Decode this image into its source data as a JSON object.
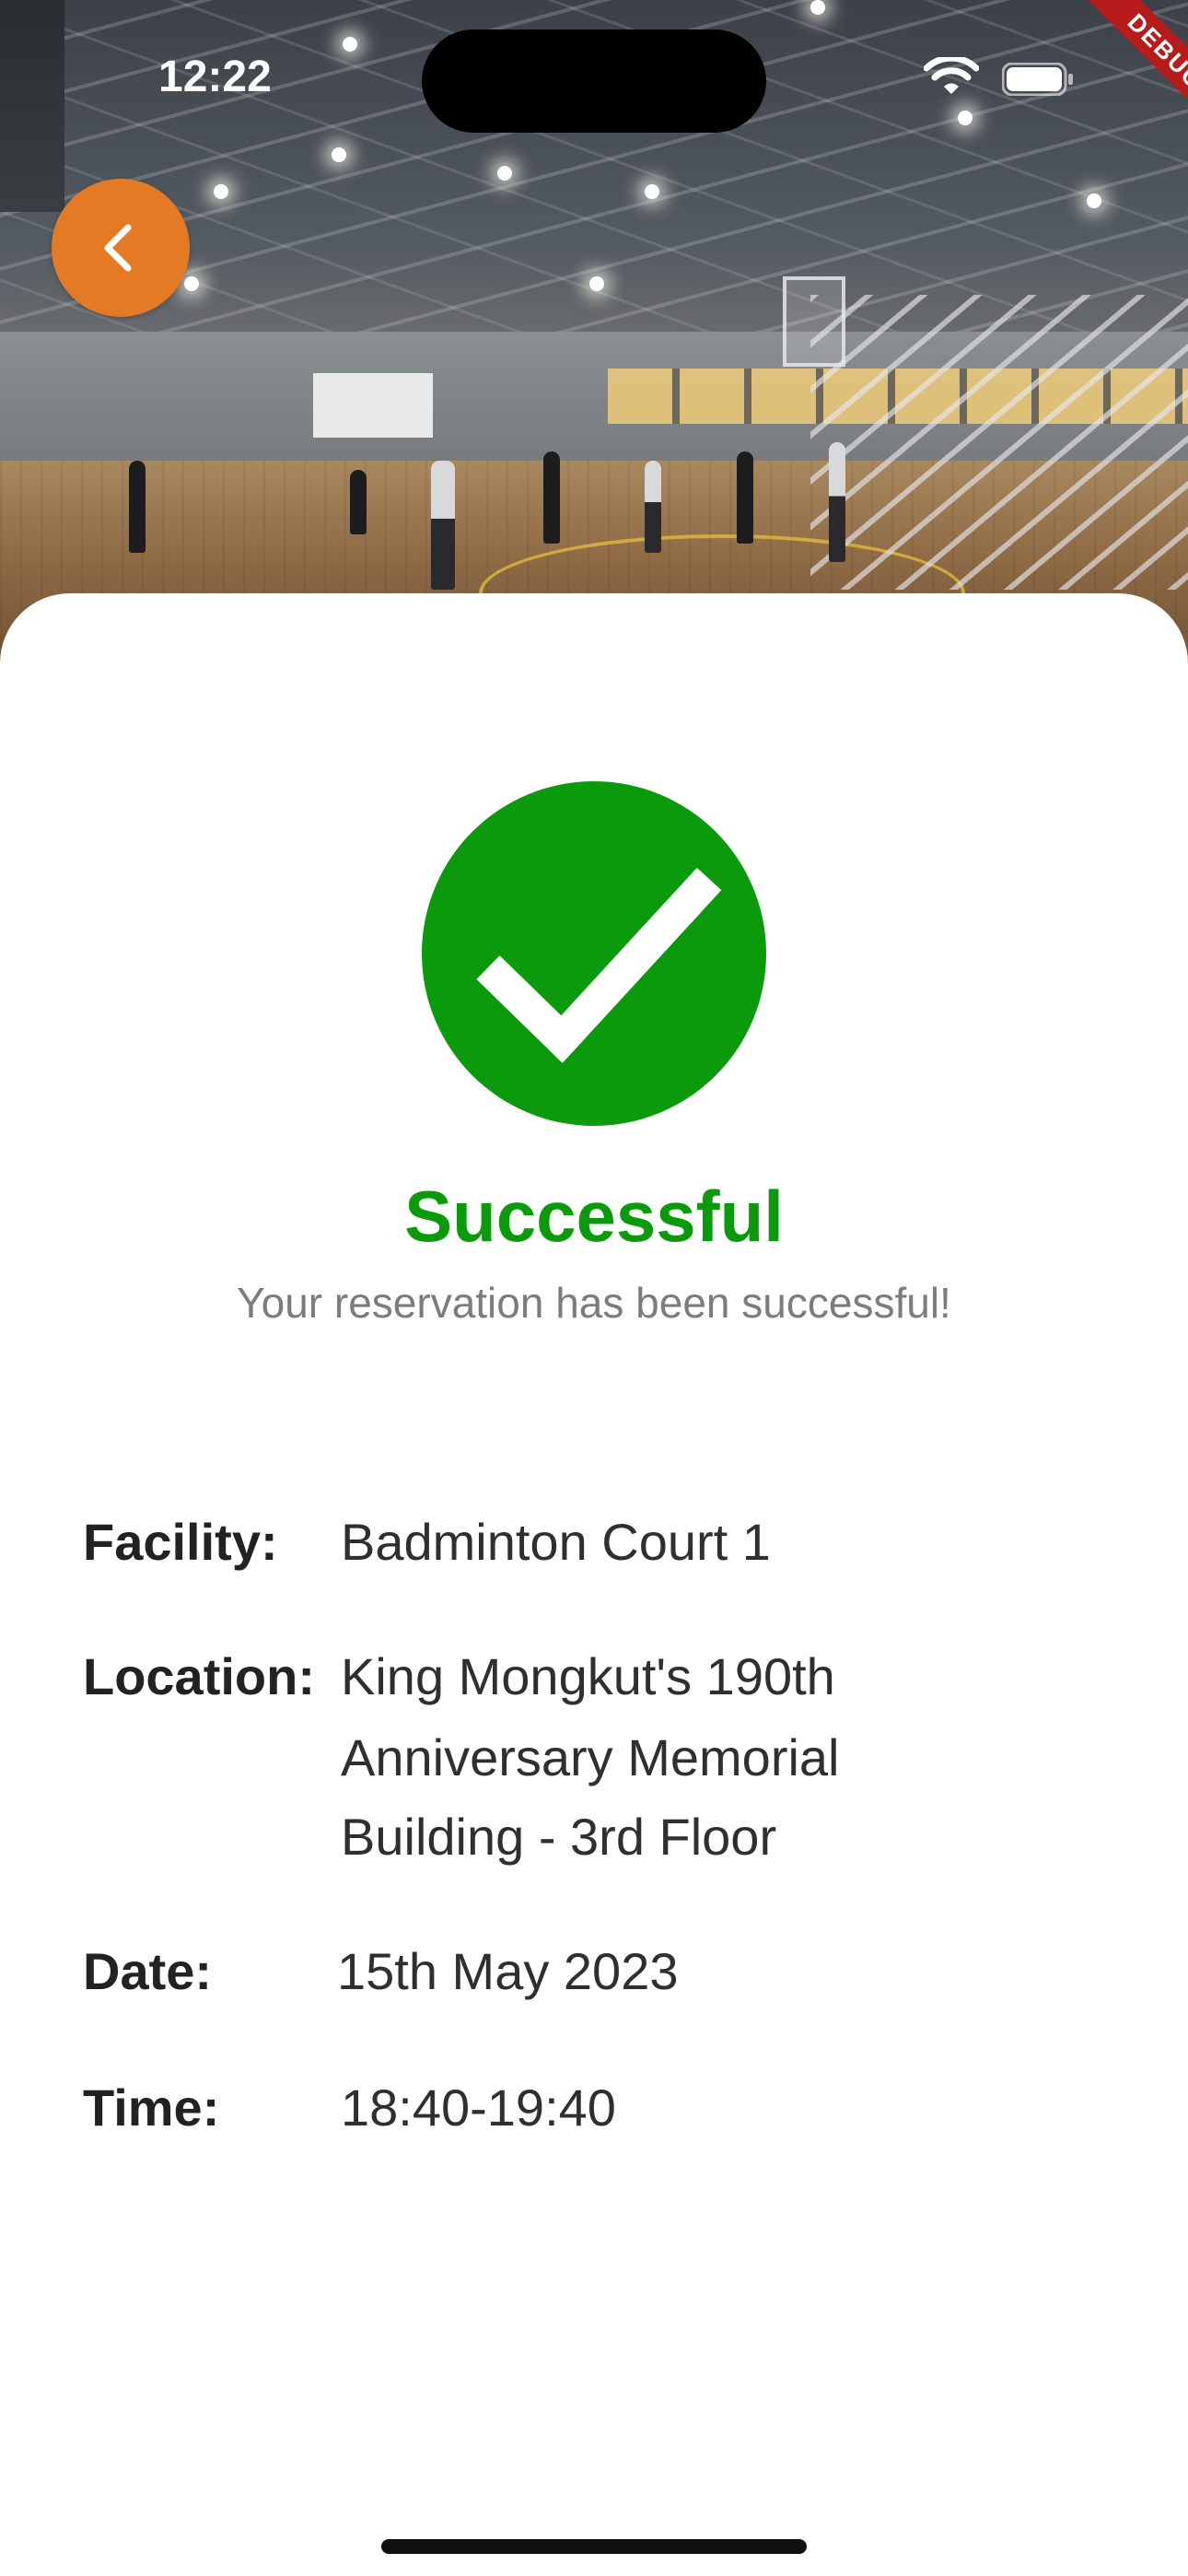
{
  "status_bar": {
    "time": "12:22",
    "wifi_icon": "wifi-icon",
    "battery_icon": "battery-icon"
  },
  "debug_banner": "DEBUG",
  "hero": {
    "image": "indoor sports hall photo",
    "back_icon": "chevron-left-icon",
    "back_color": "#e47a23"
  },
  "result": {
    "icon": "check-circle-icon",
    "icon_color": "#0b9a0b",
    "title": "Successful",
    "message": "Your reservation has been successful!"
  },
  "details": {
    "facility_label": "Facility:",
    "facility_value": "Badminton Court 1",
    "location_label": "Location:",
    "location_line1": "King Mongkut's 190th",
    "location_line2": "Anniversary Memorial",
    "location_line3": "Building - 3rd Floor",
    "date_label": "Date:",
    "date_value": "15th May 2023",
    "time_label": "Time:",
    "time_value": "18:40-19:40"
  }
}
